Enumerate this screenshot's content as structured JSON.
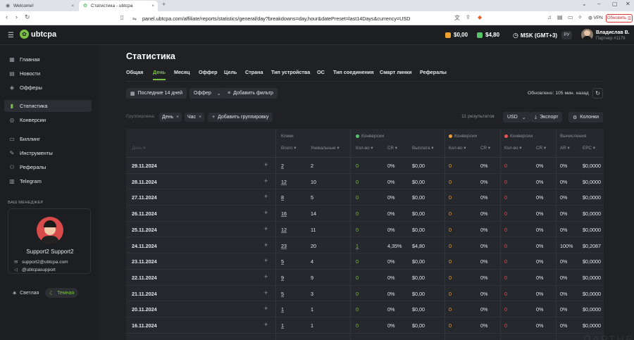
{
  "browser": {
    "tab_inactive": "Welcome!",
    "tab_active": "Статистика - ubtcpa",
    "url": "panel.ubtcpa.com/affiliate/reports/statistics/general/day?breakdowns=day,hour&datePreset=last14Days&currency=USD",
    "vpn": "VPN",
    "refresh": "Обновить"
  },
  "header": {
    "logo": "ubtcpa",
    "balances": [
      {
        "value": "$0,00",
        "color": "#f0a030"
      },
      {
        "value": "$4,80",
        "color": "#57c36a"
      }
    ],
    "timezone": "MSK (GMT+3)",
    "lang": "РУ",
    "user_name": "Владислав В.",
    "user_role": "Партнер #1179"
  },
  "sidebar": {
    "items": [
      {
        "label": "Главная",
        "icon": "grid-icon"
      },
      {
        "label": "Новости",
        "icon": "news-icon"
      },
      {
        "label": "Офферы",
        "icon": "tag-icon"
      },
      {
        "label": "Статистика",
        "icon": "chart-icon",
        "active": true
      },
      {
        "label": "Конверсии",
        "icon": "conversion-icon"
      },
      {
        "label": "Биллинг",
        "icon": "wallet-icon"
      },
      {
        "label": "Инструменты",
        "icon": "tools-icon"
      },
      {
        "label": "Рефералы",
        "icon": "referrals-icon"
      },
      {
        "label": "Telegram",
        "icon": "telegram-icon"
      }
    ],
    "manager_title": "ВАШ МЕНЕДЖЕР",
    "manager_name": "Support2 Support2",
    "manager_email": "support2@ubtcpa.com",
    "manager_telegram": "@ubtcpasupport",
    "theme_light": "Светлая",
    "theme_dark": "Темная"
  },
  "main": {
    "title": "Статистика",
    "tabs": [
      "Общая",
      "День",
      "Месяц",
      "Оффер",
      "Цель",
      "Страна",
      "Тип устройства",
      "ОС",
      "Тип соединения",
      "Смарт линки",
      "Рефералы"
    ],
    "active_tab": "День",
    "filters": {
      "period": "Последние 14 дней",
      "offer": "Оффер",
      "add_filter": "Добавить фильтр",
      "updated": "Обновлено: 105 мин. назад"
    },
    "grouping_label": "Группировка:",
    "chips": [
      "День",
      "Час"
    ],
    "add_grouping": "Добавить группировку",
    "results": "11 результатов",
    "currency": "USD",
    "export": "Экспорт",
    "columns": "Колонки"
  },
  "table": {
    "groups": {
      "clicks": "Клики",
      "conv_green": "Конверсии",
      "conv_orange": "Конверсии",
      "conv_red": "Конверсии",
      "calc": "Вычисления"
    },
    "subheaders": {
      "day": "День",
      "total": "Всего",
      "unique": "Уникальные",
      "count1": "Кол-во",
      "cr1": "CR",
      "payout": "Выплата",
      "count2": "Кол-во",
      "cr2": "CR",
      "count3": "Кол-во",
      "cr3": "CR",
      "ar": "AR",
      "epc": "EPC"
    },
    "rows": [
      {
        "date": "29.11.2024",
        "total": "2",
        "unique": "2",
        "c1": "0",
        "cr1": "0%",
        "pay": "$0,00",
        "c2": "0",
        "cr2": "0%",
        "c3": "0",
        "cr3": "0%",
        "ar": "0%",
        "epc": "$0,0000"
      },
      {
        "date": "28.11.2024",
        "total": "12",
        "unique": "10",
        "c1": "0",
        "cr1": "0%",
        "pay": "$0,00",
        "c2": "0",
        "cr2": "0%",
        "c3": "0",
        "cr3": "0%",
        "ar": "0%",
        "epc": "$0,0000"
      },
      {
        "date": "27.11.2024",
        "total": "8",
        "unique": "5",
        "c1": "0",
        "cr1": "0%",
        "pay": "$0,00",
        "c2": "0",
        "cr2": "0%",
        "c3": "0",
        "cr3": "0%",
        "ar": "0%",
        "epc": "$0,0000"
      },
      {
        "date": "26.11.2024",
        "total": "16",
        "unique": "14",
        "c1": "0",
        "cr1": "0%",
        "pay": "$0,00",
        "c2": "0",
        "cr2": "0%",
        "c3": "0",
        "cr3": "0%",
        "ar": "0%",
        "epc": "$0,0000"
      },
      {
        "date": "25.11.2024",
        "total": "12",
        "unique": "11",
        "c1": "0",
        "cr1": "0%",
        "pay": "$0,00",
        "c2": "0",
        "cr2": "0%",
        "c3": "0",
        "cr3": "0%",
        "ar": "0%",
        "epc": "$0,0000"
      },
      {
        "date": "24.11.2024",
        "total": "23",
        "unique": "20",
        "c1": "1",
        "cr1": "4,35%",
        "pay": "$4,80",
        "c2": "0",
        "cr2": "0%",
        "c3": "0",
        "cr3": "0%",
        "ar": "100%",
        "epc": "$0,2087"
      },
      {
        "date": "23.11.2024",
        "total": "5",
        "unique": "4",
        "c1": "0",
        "cr1": "0%",
        "pay": "$0,00",
        "c2": "0",
        "cr2": "0%",
        "c3": "0",
        "cr3": "0%",
        "ar": "0%",
        "epc": "$0,0000"
      },
      {
        "date": "22.11.2024",
        "total": "9",
        "unique": "9",
        "c1": "0",
        "cr1": "0%",
        "pay": "$0,00",
        "c2": "0",
        "cr2": "0%",
        "c3": "0",
        "cr3": "0%",
        "ar": "0%",
        "epc": "$0,0000"
      },
      {
        "date": "21.11.2024",
        "total": "5",
        "unique": "3",
        "c1": "0",
        "cr1": "0%",
        "pay": "$0,00",
        "c2": "0",
        "cr2": "0%",
        "c3": "0",
        "cr3": "0%",
        "ar": "0%",
        "epc": "$0,0000"
      },
      {
        "date": "20.11.2024",
        "total": "1",
        "unique": "1",
        "c1": "0",
        "cr1": "0%",
        "pay": "$0,00",
        "c2": "0",
        "cr2": "0%",
        "c3": "0",
        "cr3": "0%",
        "ar": "0%",
        "epc": "$0,0000"
      },
      {
        "date": "16.11.2024",
        "total": "1",
        "unique": "1",
        "c1": "0",
        "cr1": "0%",
        "pay": "$0,00",
        "c2": "0",
        "cr2": "0%",
        "c3": "0",
        "cr3": "0%",
        "ar": "0%",
        "epc": "$0,0000"
      }
    ]
  },
  "watermark": "ПАРТНЕРКИН"
}
